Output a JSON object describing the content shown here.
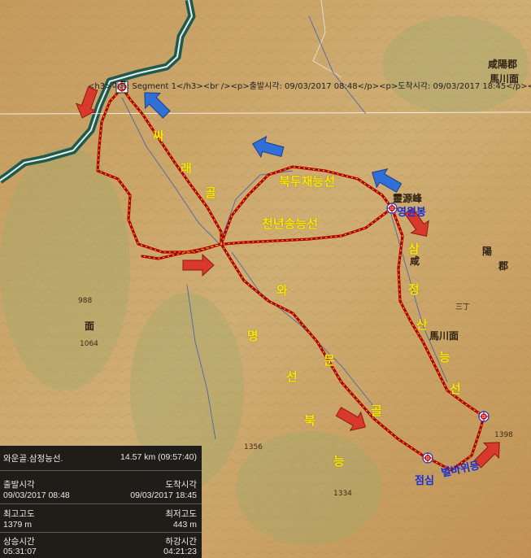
{
  "route_title": "<h3>이름: Segment 1</h3><br /><p>출발시각: 09/03/2017 08:48</p><p>도착시각: 09/03/2017 18:45</p><p>이",
  "route_labels": {
    "ssaraegol": [
      "싸",
      "래",
      "골"
    ],
    "bukdu": "북두재능선",
    "cheonnyeon": "천년송능선",
    "waumyeong": [
      "와",
      "명",
      "선",
      "문",
      "골"
    ],
    "bukneung": [
      "북",
      "능"
    ],
    "samjeong": [
      "삼",
      "정",
      "산",
      "능",
      "선"
    ]
  },
  "waypoints": {
    "yeongwonbong": "영원봉",
    "lunch": "점심",
    "byeolbawi": "별바위등"
  },
  "map_text": {
    "t1": "靈源峰",
    "t2": "咸陽郡",
    "t3": "馬川面",
    "t4": "三丁",
    "t5": "馬川面",
    "t6": "陽",
    "t7": "郡",
    "t8": "咸",
    "t9": "面",
    "t10": "1064",
    "t11": "988",
    "t12": "1334",
    "t13": "1398",
    "t14": "1356"
  },
  "stats_panel": {
    "track_name": "와운골.삼정능선.",
    "distance_time": "14.57 km (09:57:40)",
    "start_label": "출발시각",
    "start_value": "09/03/2017 08:48",
    "end_label": "도착시각",
    "end_value": "09/03/2017 18:45",
    "max_alt_label": "최고고도",
    "max_alt_value": "1379 m",
    "min_alt_label": "최저고도",
    "min_alt_value": "443 m",
    "ascent_label": "상승시간",
    "ascent_value": "05:31:07",
    "descent_label": "하강시간",
    "descent_value": "04:21:23"
  },
  "colors": {
    "track": "#b00000",
    "track_dots": "#ffd400",
    "blue_arrow": "#2f6fd6",
    "red_arrow": "#d8392a",
    "river": "#1f5a4e",
    "label_yellow": "#ffe600",
    "label_blue": "#1a2ed6"
  }
}
